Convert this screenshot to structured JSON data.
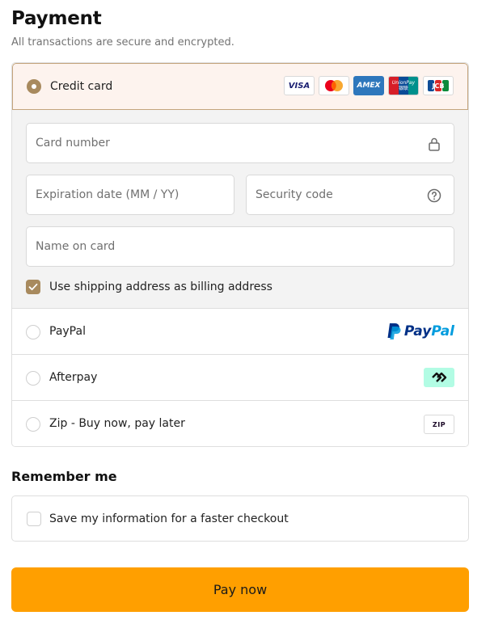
{
  "header": {
    "title": "Payment",
    "subtitle": "All transactions are secure and encrypted."
  },
  "payment_options": {
    "credit_card": {
      "label": "Credit card",
      "selected": true,
      "brands": [
        "VISA",
        "Mastercard",
        "AMEX",
        "UnionPay",
        "JCB"
      ],
      "brand_texts": {
        "visa": "VISA",
        "amex": "AMEX",
        "unionpay": "UnionPay",
        "unionpay_cn": "银联",
        "jcb": "JCB"
      },
      "fields": {
        "card_number": "Card number",
        "expiration": "Expiration date (MM / YY)",
        "security_code": "Security code",
        "name_on_card": "Name on card"
      },
      "billing_checkbox": {
        "label": "Use shipping address as billing address",
        "checked": true
      }
    },
    "paypal": {
      "label": "PayPal",
      "logo_text_1": "Pay",
      "logo_text_2": "Pal",
      "selected": false
    },
    "afterpay": {
      "label": "Afterpay",
      "selected": false
    },
    "zip": {
      "label": "Zip - Buy now, pay later",
      "logo_text": "ZIP",
      "selected": false
    }
  },
  "remember": {
    "title": "Remember me",
    "checkbox_label": "Save my information for a faster checkout",
    "checked": false
  },
  "pay_button": {
    "label": "Pay now"
  },
  "colors": {
    "accent": "#a88a5e",
    "selected_bg": "#fdf3ee",
    "pay_button": "#ff9f00",
    "afterpay_mint": "#b2fce4"
  }
}
